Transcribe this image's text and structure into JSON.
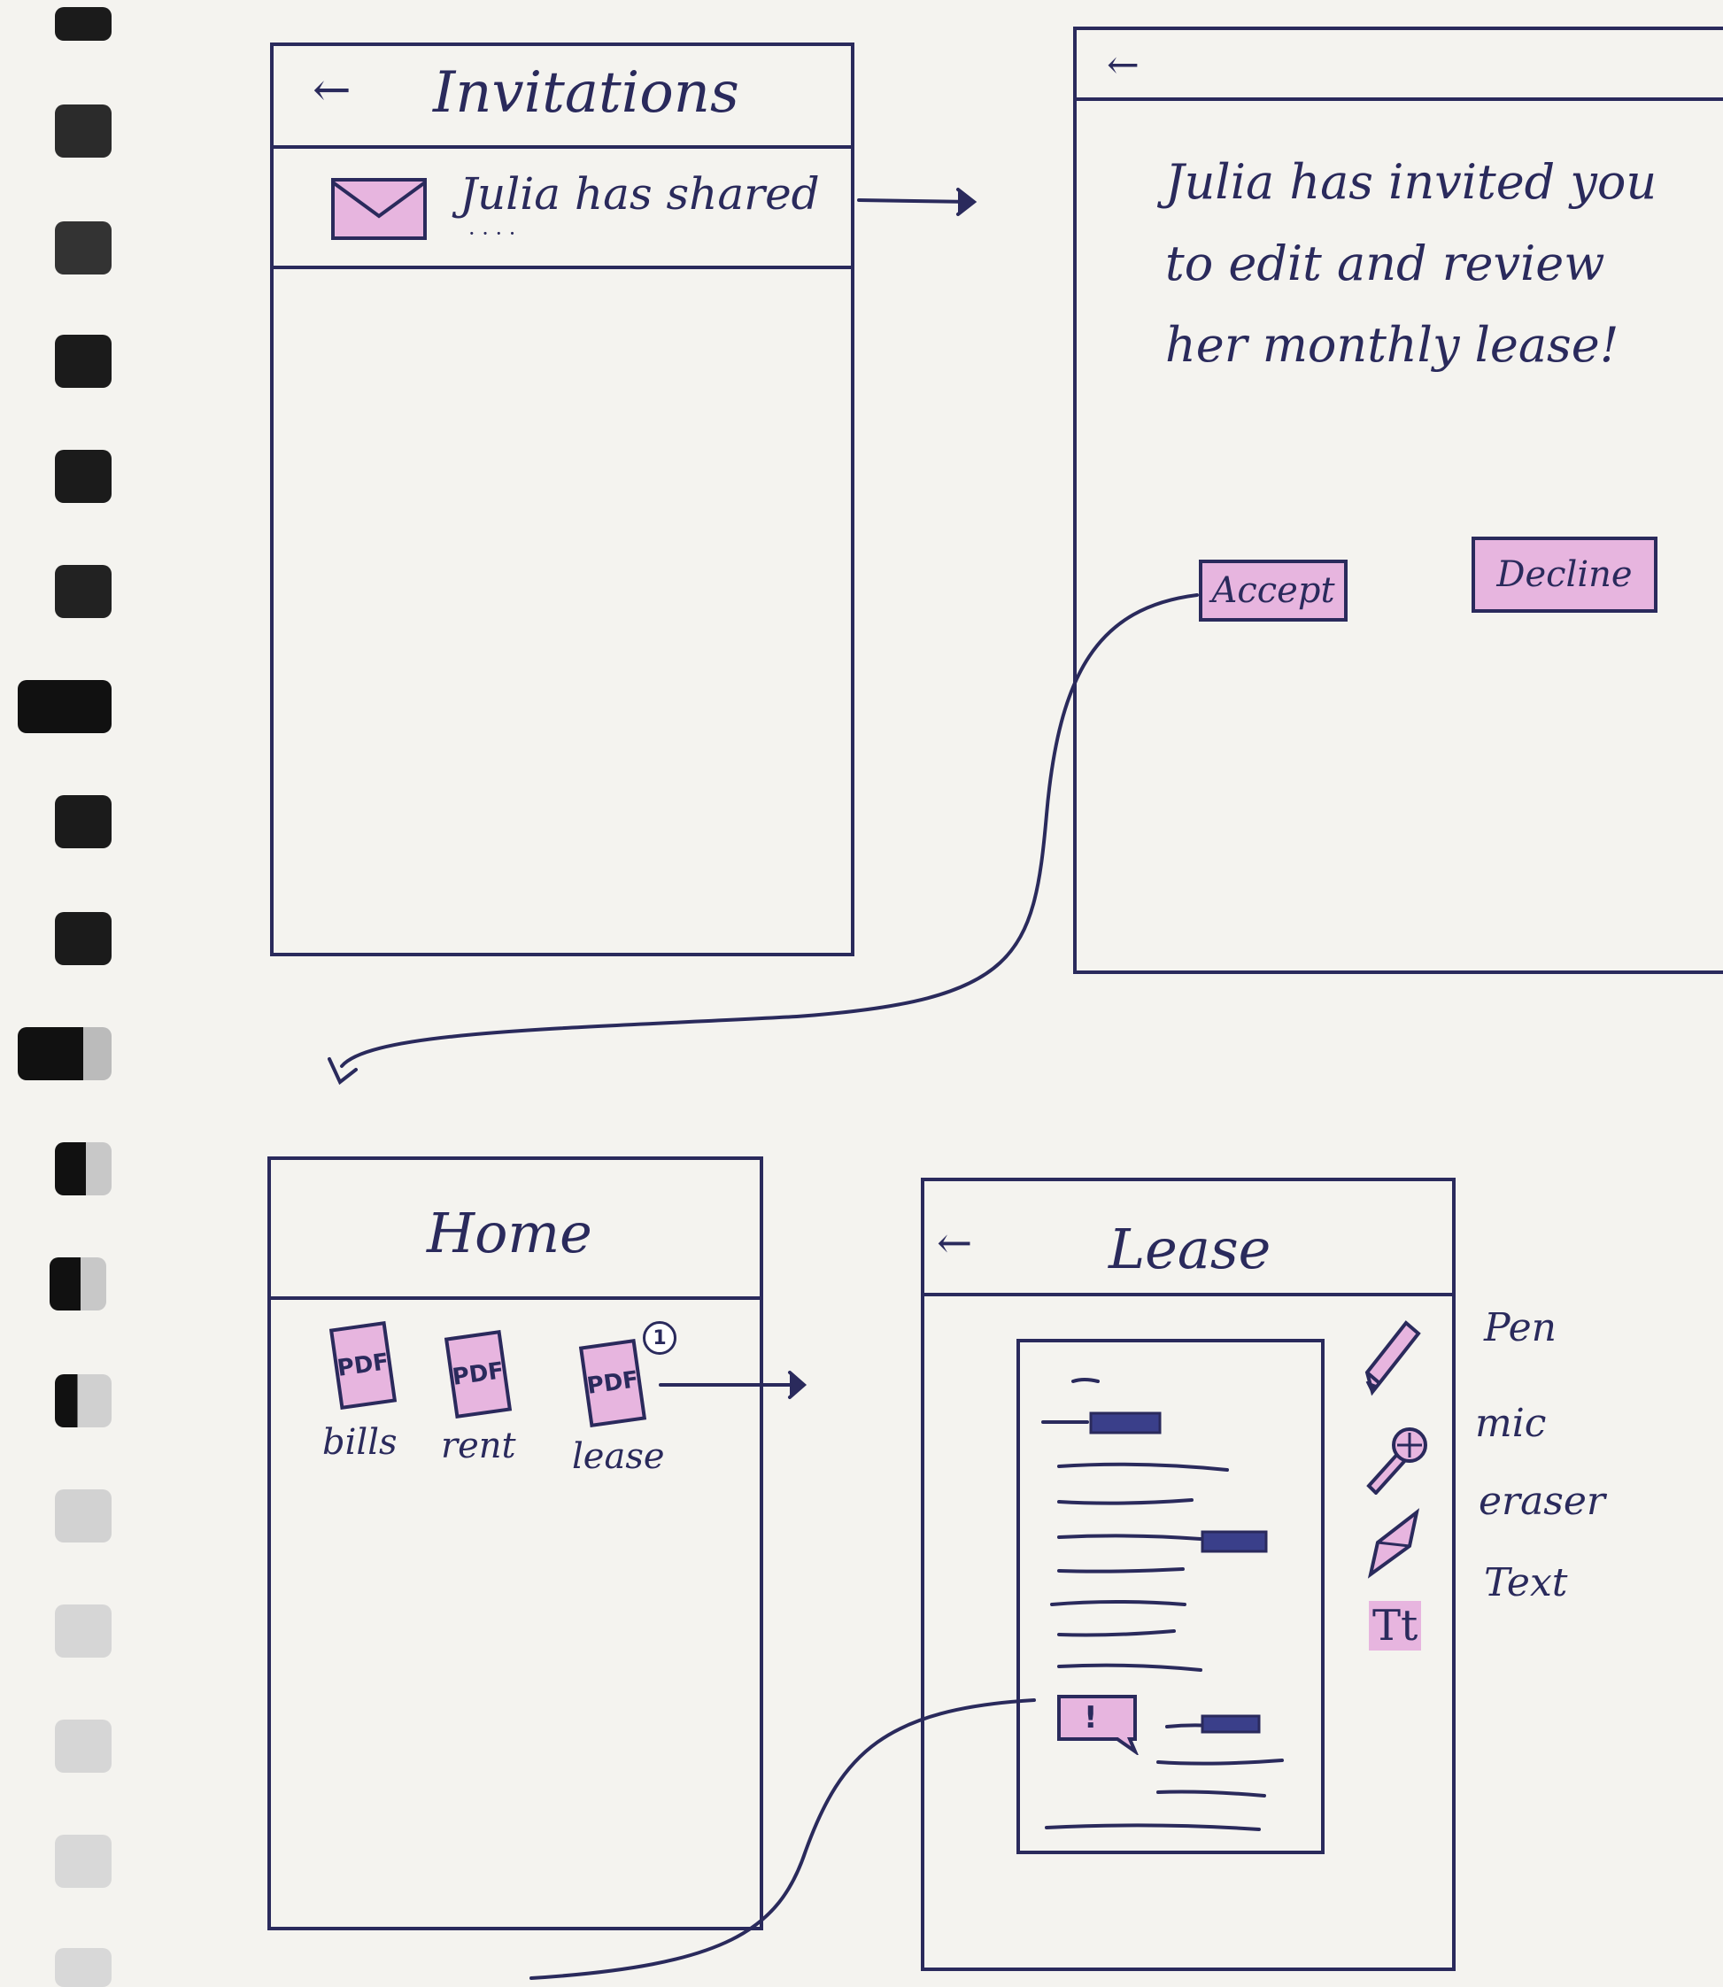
{
  "invitations": {
    "title": "Invitations",
    "item_text": "Julia has shared",
    "item_ellipsis": "· · · ·"
  },
  "invite_detail": {
    "message": "Julia has invited you to edit and review her monthly lease!",
    "accept_label": "Accept",
    "decline_label": "Decline"
  },
  "home": {
    "title": "Home",
    "files": [
      {
        "icon_text": "PDF",
        "label": "bills"
      },
      {
        "icon_text": "PDF",
        "label": "rent"
      },
      {
        "icon_text": "PDF",
        "label": "lease",
        "badge": "1"
      }
    ]
  },
  "lease": {
    "title": "Lease",
    "comment_symbol": "!",
    "tools": [
      {
        "icon": "pen-icon",
        "label": "Pen"
      },
      {
        "icon": "mic-icon",
        "label": "mic"
      },
      {
        "icon": "eraser-icon",
        "label": "eraser"
      },
      {
        "icon": "text-icon",
        "glyph": "Tt",
        "label": "Text"
      }
    ]
  },
  "colors": {
    "ink": "#2a2a5c",
    "highlight": "#e7b5df",
    "paper": "#f4f3ef"
  }
}
